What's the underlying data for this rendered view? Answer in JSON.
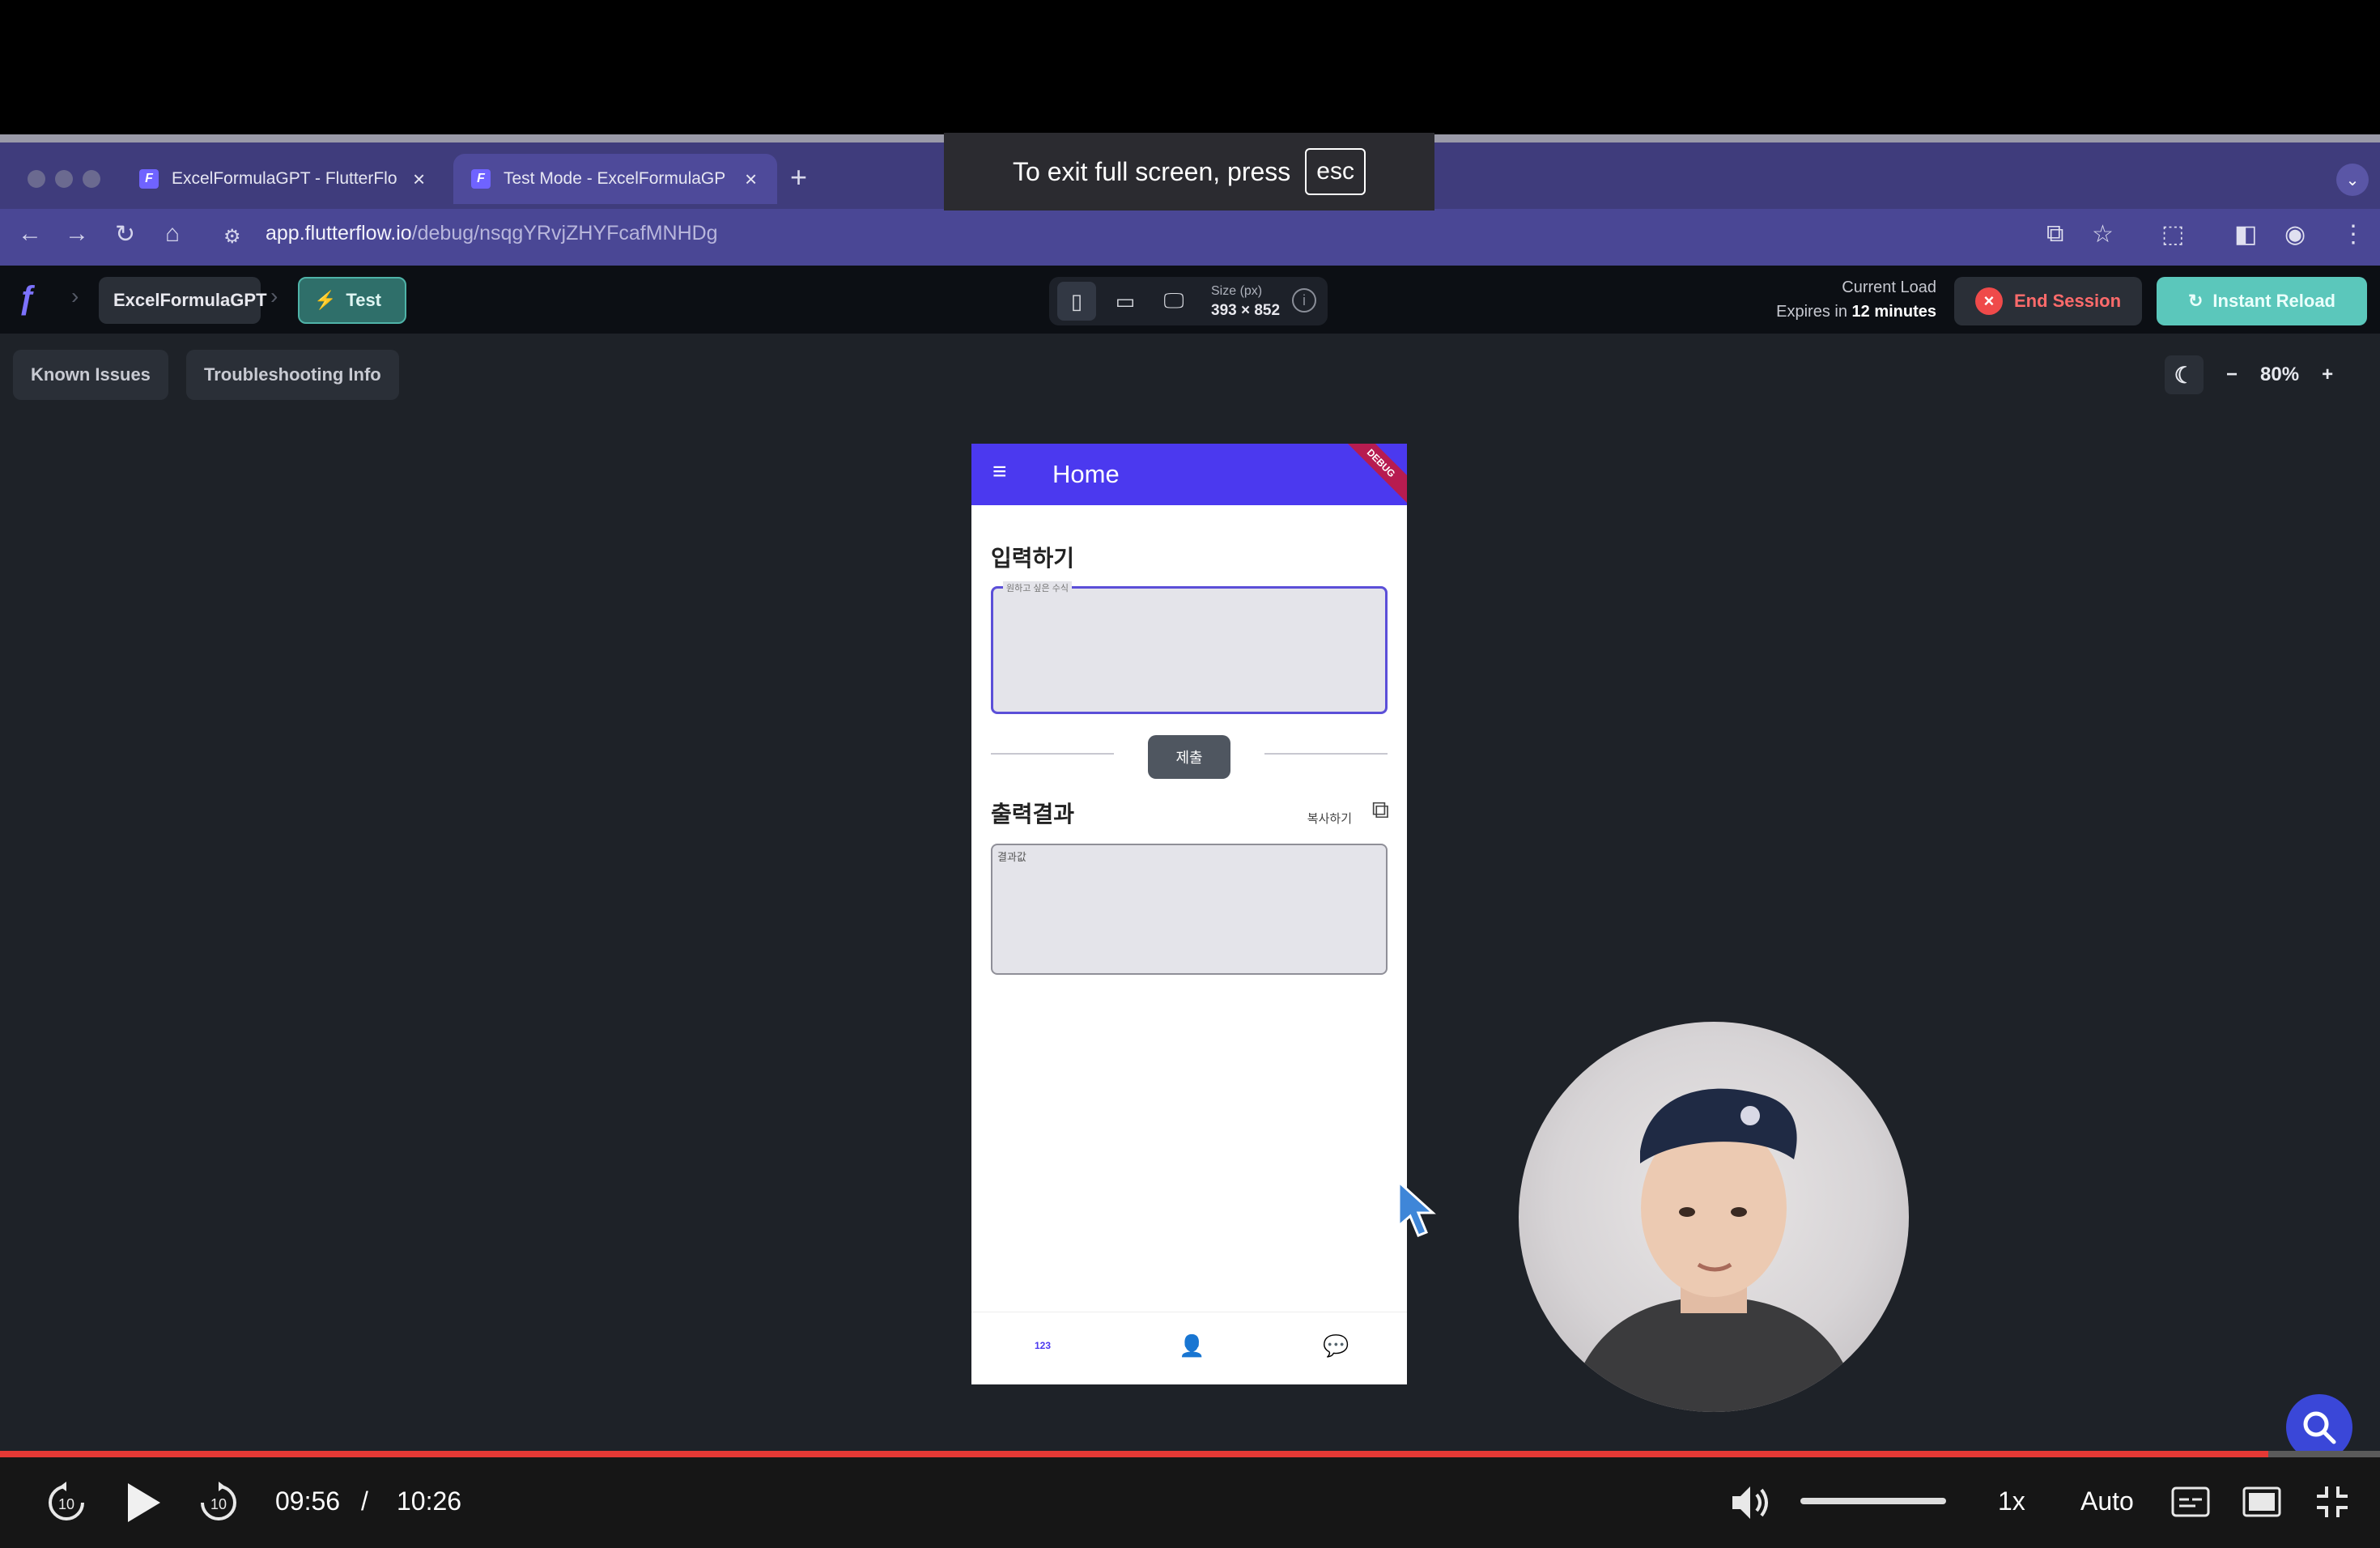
{
  "browser": {
    "tabs": [
      {
        "title": "ExcelFormulaGPT - FlutterFlo",
        "active": false
      },
      {
        "title": "Test Mode - ExcelFormulaGP",
        "active": true
      }
    ],
    "url_host": "app.flutterflow.io",
    "url_path": "/debug/nsqgYRvjZHYFcafMNHDg"
  },
  "fullscreen_notice": {
    "text": "To exit full screen, press",
    "key": "esc"
  },
  "flutterflow": {
    "project": "ExcelFormulaGPT",
    "mode": "Test",
    "size_label": "Size (px)",
    "size_value": "393 × 852",
    "load_label": "Current Load",
    "expires_prefix": "Expires in",
    "expires_value": "12 minutes",
    "end_session": "End Session",
    "instant_reload": "Instant Reload",
    "known_issues": "Known Issues",
    "troubleshooting": "Troubleshooting Info",
    "zoom": "80%"
  },
  "app": {
    "title": "Home",
    "debug_banner": "DEBUG",
    "input_section": "입력하기",
    "input_label": "원하고 싶은 수식",
    "submit": "제출",
    "output_section": "출력결과",
    "copy_label": "복사하기",
    "output_hint": "결과값",
    "nav_active": "123"
  },
  "video": {
    "current_time": "09:56",
    "separator": "/",
    "duration": "10:26",
    "progress": 0.953,
    "speed": "1x",
    "quality": "Auto",
    "skip_back": "10",
    "skip_forward": "10"
  },
  "colors": {
    "accent": "#4b39ef",
    "progress": "#e53935",
    "reload": "#5bc7bb",
    "end_session": "#ef4a4a"
  }
}
